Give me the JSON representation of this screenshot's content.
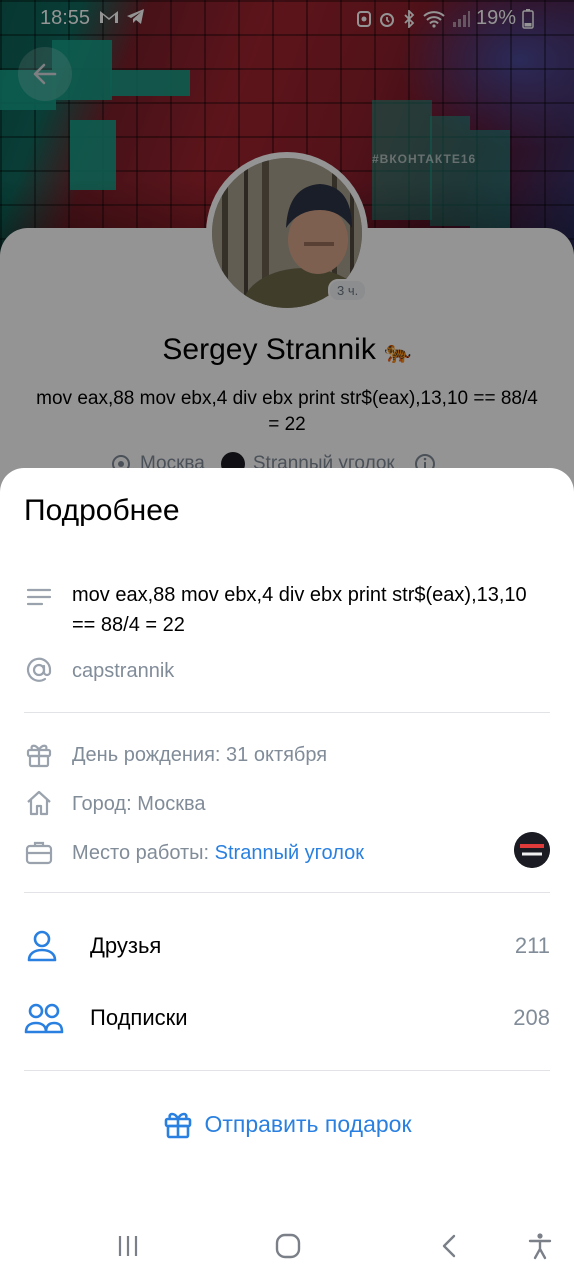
{
  "status_bar": {
    "time": "18:55",
    "battery": "19%"
  },
  "cover": {
    "hashtag": "#ВКОНТАКТЕ16"
  },
  "profile": {
    "name": "Sergey Strannik",
    "name_emoji": "🐅",
    "avatar_badge": "3 ч.",
    "status": "mov eax,88 mov ebx,4 div ebx print str$(eax),13,10 == 88/4 = 22",
    "city": "Москва",
    "work": "Strannый уголок"
  },
  "sheet": {
    "title": "Подробнее",
    "about": "mov eax,88 mov ebx,4 div ebx print str$(eax),13,10 == 88/4 = 22",
    "username": "capstrannik",
    "birthday": "День рождения: 31 октября",
    "city": "Город: Москва",
    "work_label": "Место работы: ",
    "work_name": "Strannый уголок",
    "friends_label": "Друзья",
    "friends_count": "211",
    "subscriptions_label": "Подписки",
    "subscriptions_count": "208",
    "gift_button": "Отправить подарок"
  },
  "colors": {
    "accent": "#2a80e0",
    "secondary_text": "#818c99",
    "separator": "#e1e3e6"
  },
  "icons": [
    "back-arrow-icon",
    "text-lines-icon",
    "at-icon",
    "gift-icon",
    "home-icon",
    "briefcase-icon",
    "person-icon",
    "people-icon",
    "recent-apps-icon",
    "home-circle-icon",
    "back-chevron-icon",
    "accessibility-icon"
  ]
}
